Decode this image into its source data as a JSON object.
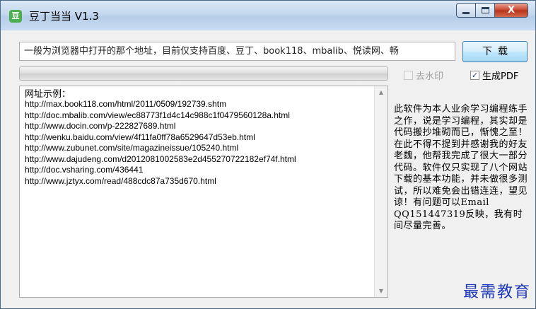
{
  "window": {
    "icon": "bean-app-icon",
    "title": "豆丁当当  V1.3",
    "controls": {
      "minimize": "minimize",
      "maximize": "maximize",
      "close": "close"
    },
    "close_glyph": "X"
  },
  "url_input": {
    "value": "一般为浏览器中打开的那个地址，目前仅支持百度、豆丁、book118、mbalib、悦读网、畅"
  },
  "download_button": {
    "label": "下载"
  },
  "progress": {
    "value_percent": 0,
    "fill_color": "#3ca34a"
  },
  "options": {
    "remove_watermark": {
      "label": "去水印",
      "checked": false,
      "enabled": false
    },
    "generate_pdf": {
      "label": "生成PDF",
      "checked": true,
      "enabled": true,
      "check_glyph": "✓"
    }
  },
  "examples": {
    "heading": "网址示例：",
    "urls": [
      "http://max.book118.com/html/2011/0509/192739.shtm",
      "http://doc.mbalib.com/view/ec88773f1d4c14c988c1f0479560128a.html",
      "http://www.docin.com/p-222827689.html",
      "http://wenku.baidu.com/view/4f11fa0ff78a6529647d53eb.html",
      "http://www.zubunet.com/site/magazineissue/105240.html",
      "http://www.dajudeng.com/d2012081002583e2d455270722182ef74f.html",
      "http://doc.vsharing.com/436441",
      "http://www.jztyx.com/read/488cdc87a735d670.html"
    ]
  },
  "scrollbar": {
    "up_glyph": "▲",
    "down_glyph": "▼"
  },
  "info": {
    "text": "此软件为本人业余学习编程练手之作，说是学习编程，其实却是代码搬抄堆砌而已，惭愧之至！在此不得不提到并感谢我的好友老魏，他帮我完成了很大一部分代码。软件仅只实现了八个网站下载的基本功能，并未做很多测试，所以难免会出错连连，望见谅！有问题可以Email QQ151447319反映，我有时间尽量完善。"
  },
  "watermark": {
    "text": "最需教育"
  }
}
